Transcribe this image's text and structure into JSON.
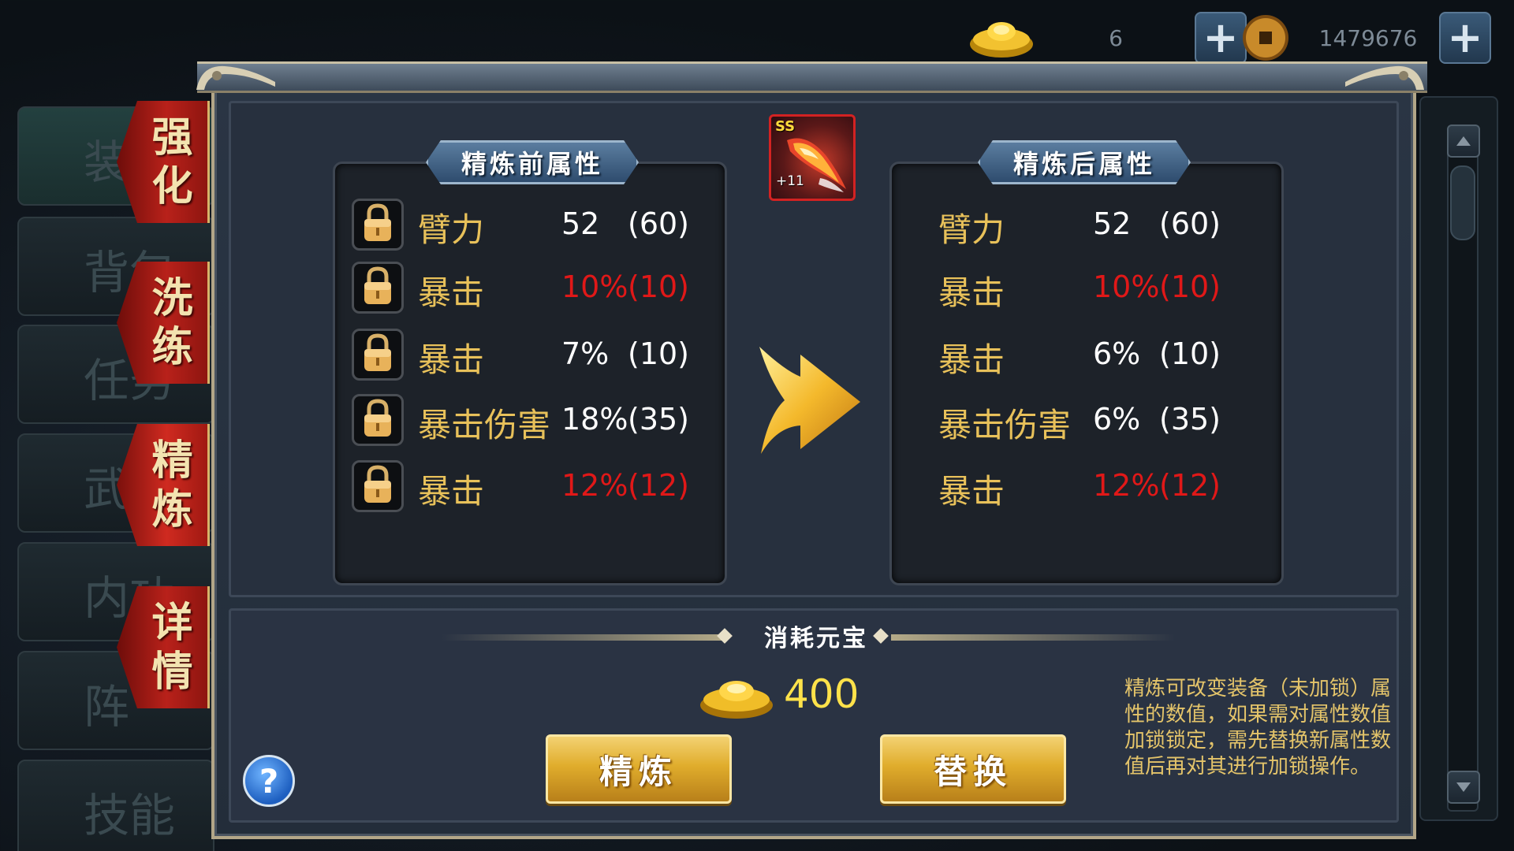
{
  "currency": {
    "ingot_icon": "gold-ingot-icon",
    "ingot_value": "6",
    "coin_icon": "copper-coin-icon",
    "coin_value": "1479676",
    "plus_symbol": "+"
  },
  "left_menu": {
    "background_tabs": [
      "装",
      "背包",
      "任务",
      "武",
      "内功",
      "阵",
      "技能"
    ],
    "red_tabs": [
      {
        "label_1": "强",
        "label_2": "化"
      },
      {
        "label_1": "洗",
        "label_2": "练"
      },
      {
        "label_1": "精",
        "label_2": "炼",
        "active": true
      },
      {
        "label_1": "详",
        "label_2": "情"
      }
    ]
  },
  "item": {
    "grade": "SS",
    "level": "+11"
  },
  "before": {
    "title": "精炼前属性",
    "stats": [
      {
        "name": "臂力",
        "value": "52",
        "cap": "(60)",
        "red": false
      },
      {
        "name": "暴击",
        "value": "10%",
        "cap": "(10)",
        "red": true
      },
      {
        "name": "暴击",
        "value": "7%",
        "cap": "(10)",
        "red": false
      },
      {
        "name": "暴击伤害",
        "value": "18%",
        "cap": "(35)",
        "red": false
      },
      {
        "name": "暴击",
        "value": "12%",
        "cap": "(12)",
        "red": true
      }
    ]
  },
  "after": {
    "title": "精炼后属性",
    "stats": [
      {
        "name": "臂力",
        "value": "52",
        "cap": "(60)",
        "red": false
      },
      {
        "name": "暴击",
        "value": "10%",
        "cap": "(10)",
        "red": true
      },
      {
        "name": "暴击",
        "value": "6%",
        "cap": "(10)",
        "red": false
      },
      {
        "name": "暴击伤害",
        "value": "6%",
        "cap": "(35)",
        "red": false
      },
      {
        "name": "暴击",
        "value": "12%",
        "cap": "(12)",
        "red": true
      }
    ]
  },
  "cost": {
    "title": "消耗元宝",
    "amount": "400"
  },
  "buttons": {
    "refine": "精炼",
    "replace": "替换",
    "help": "?"
  },
  "hint": "精炼可改变装备（未加锁）属性的数值，如果需对属性数值加锁锁定，需先替换新属性数值后再对其进行加锁操作。",
  "colors": {
    "stat_name": "#e8c15a",
    "highlight_red": "#e01818",
    "cost_amount": "#ffe24a"
  }
}
